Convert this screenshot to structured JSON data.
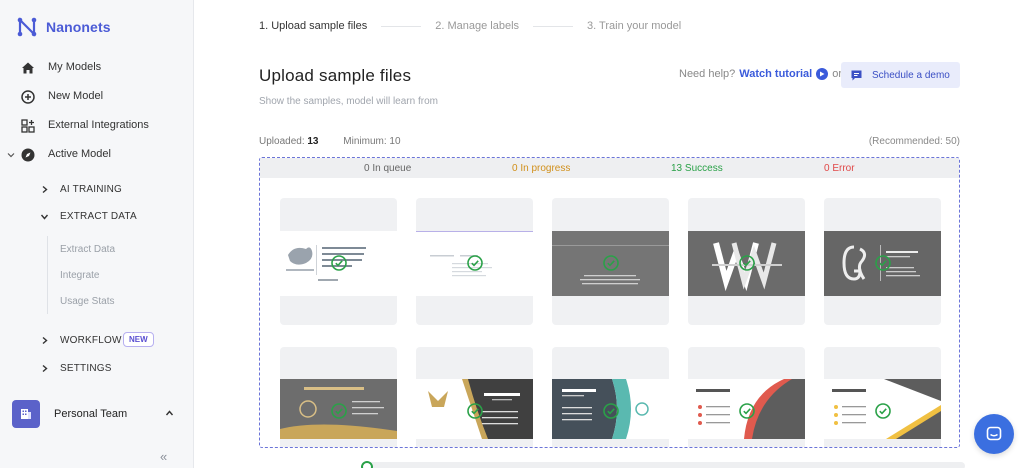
{
  "app": {
    "name": "Nanonets"
  },
  "sidebar": {
    "items": [
      {
        "label": "My Models",
        "icon": "home-icon"
      },
      {
        "label": "New Model",
        "icon": "plus-circle-icon"
      },
      {
        "label": "External Integrations",
        "icon": "grid-plus-icon"
      },
      {
        "label": "Active Model",
        "icon": "compass-icon"
      }
    ],
    "sections": [
      {
        "label": "AI TRAINING"
      },
      {
        "label": "EXTRACT DATA"
      },
      {
        "label": "WORKFLOW",
        "badge": "NEW"
      },
      {
        "label": "SETTINGS"
      }
    ],
    "extract_items": [
      "Extract Data",
      "Integrate",
      "Usage Stats"
    ],
    "team": {
      "label": "Personal Team"
    },
    "collapse_label": "«"
  },
  "stepper": {
    "steps": [
      "1.  Upload sample files",
      "2.  Manage labels",
      "3.  Train your model"
    ]
  },
  "main": {
    "title": "Upload sample files",
    "subtitle": "Show the samples, model will learn from",
    "help_prefix": "Need help?",
    "help_link": "Watch tutorial",
    "help_or": "or",
    "demo_button": "Schedule a demo",
    "uploaded_label": "Uploaded:",
    "uploaded_value": "13",
    "minimum_label": "Minimum:",
    "minimum_value": "10",
    "recommended": "(Recommended: 50)"
  },
  "status": {
    "queue": "0 In queue",
    "progress": "0 In progress",
    "success": "13 Success",
    "error": "0 Error"
  },
  "colors": {
    "accent": "#3b5bdb",
    "success": "#2aa148",
    "progress": "#d1901b",
    "error": "#e04848"
  }
}
